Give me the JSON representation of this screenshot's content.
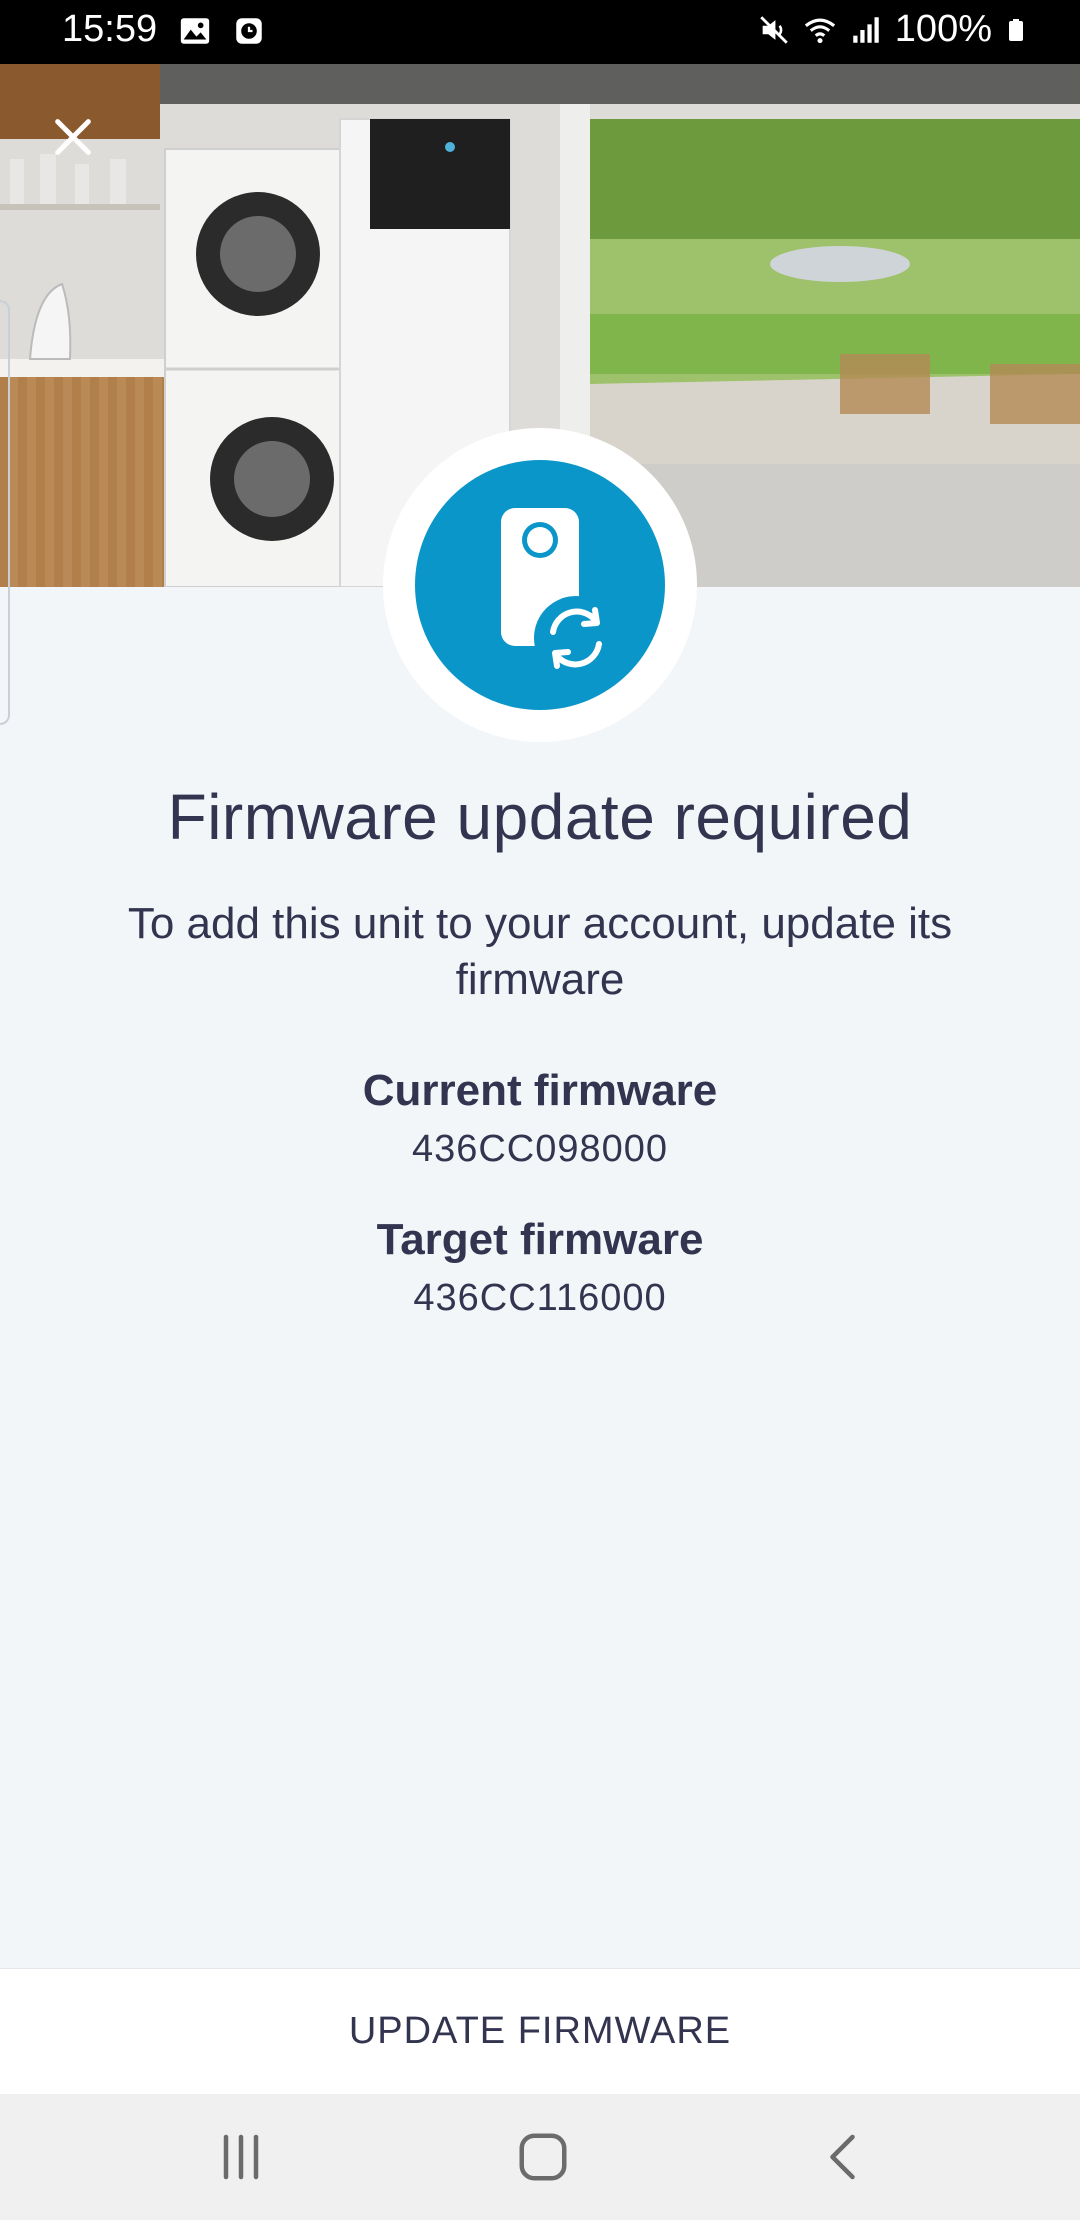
{
  "status_bar": {
    "time": "15:59",
    "battery": "100%",
    "icons": [
      "gallery-icon",
      "alarm-icon",
      "mute-icon",
      "wifi-icon",
      "signal-icon",
      "battery-icon"
    ]
  },
  "header": {
    "close_icon": "close-icon",
    "hero_image": "laundry-room-with-heat-pump-photo"
  },
  "device_icon": "device-update-icon",
  "main": {
    "title": "Firmware update required",
    "subtitle": "To add this unit to your account, update its firmware",
    "current_label": "Current firmware",
    "current_value": "436CC098000",
    "target_label": "Target firmware",
    "target_value": "436CC116000"
  },
  "action": {
    "update_label": "UPDATE FIRMWARE"
  },
  "nav": {
    "icons": [
      "recent-apps-icon",
      "home-icon",
      "back-icon"
    ]
  },
  "colors": {
    "accent": "#0a96c9",
    "text": "#33344f",
    "background": "#f3f6f9"
  }
}
